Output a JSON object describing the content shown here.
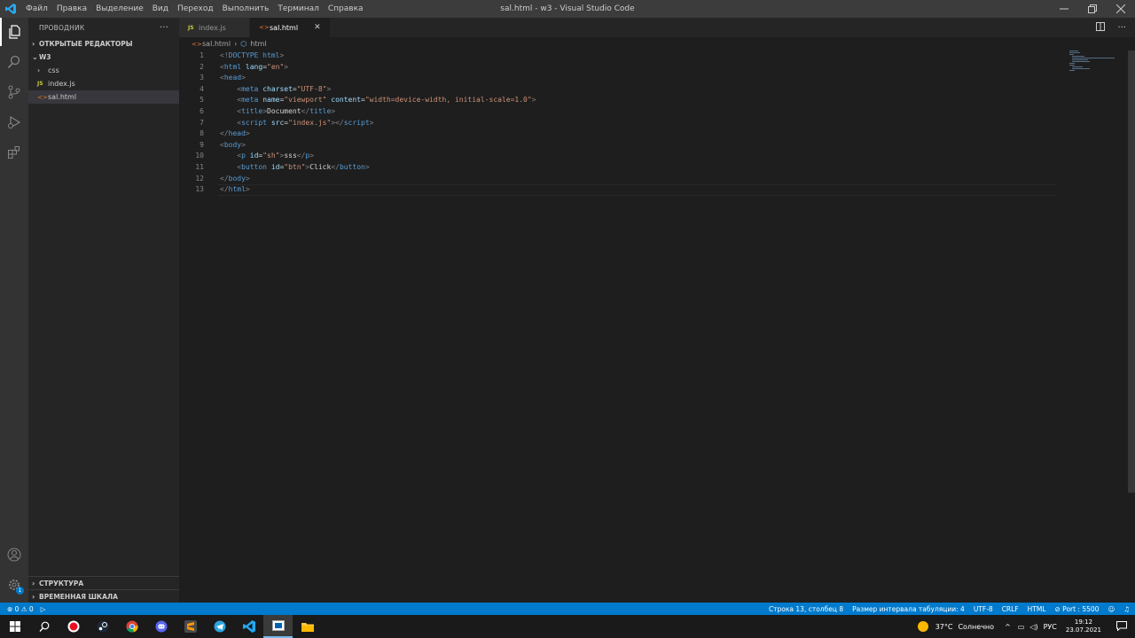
{
  "titlebar": {
    "menu": [
      "Файл",
      "Правка",
      "Выделение",
      "Вид",
      "Переход",
      "Выполнить",
      "Терминал",
      "Справка"
    ],
    "window_title": "sal.html - w3 - Visual Studio Code"
  },
  "sidebar": {
    "header": "ПРОВОДНИК",
    "more": "···",
    "open_editors": "ОТКРЫТЫЕ РЕДАКТОРЫ",
    "folder": "W3",
    "items": [
      {
        "label": "css",
        "type": "folder"
      },
      {
        "label": "index.js",
        "type": "js",
        "badge": "JS"
      },
      {
        "label": "sal.html",
        "type": "html",
        "badge": "<>"
      }
    ],
    "structure": "СТРУКТУРА",
    "timeline": "ВРЕМЕННАЯ ШКАЛА"
  },
  "tabs": [
    {
      "label": "index.js",
      "badge": "JS",
      "active": false
    },
    {
      "label": "sal.html",
      "badge": "<>",
      "active": true
    }
  ],
  "breadcrumbs": {
    "file": "sal.html",
    "symbol": "html"
  },
  "code_lines": [
    {
      "n": "1",
      "tokens": [
        [
          "p",
          "<!"
        ],
        [
          "d",
          "DOCTYPE "
        ],
        [
          "t",
          "html"
        ],
        [
          "p",
          ">"
        ]
      ]
    },
    {
      "n": "2",
      "tokens": [
        [
          "p",
          "<"
        ],
        [
          "t",
          "html"
        ],
        [
          "x",
          " "
        ],
        [
          "a",
          "lang"
        ],
        [
          "x",
          "="
        ],
        [
          "s",
          "\"en\""
        ],
        [
          "p",
          ">"
        ]
      ]
    },
    {
      "n": "3",
      "tokens": [
        [
          "p",
          "<"
        ],
        [
          "t",
          "head"
        ],
        [
          "p",
          ">"
        ]
      ]
    },
    {
      "n": "4",
      "tokens": [
        [
          "x",
          "    "
        ],
        [
          "p",
          "<"
        ],
        [
          "t",
          "meta"
        ],
        [
          "x",
          " "
        ],
        [
          "a",
          "charset"
        ],
        [
          "x",
          "="
        ],
        [
          "s",
          "\"UTF-8\""
        ],
        [
          "p",
          ">"
        ]
      ]
    },
    {
      "n": "5",
      "tokens": [
        [
          "x",
          "    "
        ],
        [
          "p",
          "<"
        ],
        [
          "t",
          "meta"
        ],
        [
          "x",
          " "
        ],
        [
          "a",
          "name"
        ],
        [
          "x",
          "="
        ],
        [
          "s",
          "\"viewport\""
        ],
        [
          "x",
          " "
        ],
        [
          "a",
          "content"
        ],
        [
          "x",
          "="
        ],
        [
          "s",
          "\"width=device-width, initial-scale=1.0\""
        ],
        [
          "p",
          ">"
        ]
      ]
    },
    {
      "n": "6",
      "tokens": [
        [
          "x",
          "    "
        ],
        [
          "p",
          "<"
        ],
        [
          "t",
          "title"
        ],
        [
          "p",
          ">"
        ],
        [
          "x",
          "Document"
        ],
        [
          "p",
          "</"
        ],
        [
          "t",
          "title"
        ],
        [
          "p",
          ">"
        ]
      ]
    },
    {
      "n": "7",
      "tokens": [
        [
          "x",
          "    "
        ],
        [
          "p",
          "<"
        ],
        [
          "t",
          "script"
        ],
        [
          "x",
          " "
        ],
        [
          "a",
          "src"
        ],
        [
          "x",
          "="
        ],
        [
          "s",
          "\"index.js\""
        ],
        [
          "p",
          "></"
        ],
        [
          "t",
          "script"
        ],
        [
          "p",
          ">"
        ]
      ]
    },
    {
      "n": "8",
      "tokens": [
        [
          "p",
          "</"
        ],
        [
          "t",
          "head"
        ],
        [
          "p",
          ">"
        ]
      ]
    },
    {
      "n": "9",
      "tokens": [
        [
          "p",
          "<"
        ],
        [
          "t",
          "body"
        ],
        [
          "p",
          ">"
        ]
      ]
    },
    {
      "n": "10",
      "tokens": [
        [
          "x",
          "    "
        ],
        [
          "p",
          "<"
        ],
        [
          "t",
          "p"
        ],
        [
          "x",
          " "
        ],
        [
          "a",
          "id"
        ],
        [
          "x",
          "="
        ],
        [
          "s",
          "\"sh\""
        ],
        [
          "p",
          ">"
        ],
        [
          "x",
          "sss"
        ],
        [
          "p",
          "</"
        ],
        [
          "t",
          "p"
        ],
        [
          "p",
          ">"
        ]
      ]
    },
    {
      "n": "11",
      "tokens": [
        [
          "x",
          "    "
        ],
        [
          "p",
          "<"
        ],
        [
          "t",
          "button"
        ],
        [
          "x",
          " "
        ],
        [
          "a",
          "id"
        ],
        [
          "x",
          "="
        ],
        [
          "s",
          "\"btn\""
        ],
        [
          "p",
          ">"
        ],
        [
          "x",
          "Click"
        ],
        [
          "p",
          "</"
        ],
        [
          "t",
          "button"
        ],
        [
          "p",
          ">"
        ]
      ]
    },
    {
      "n": "12",
      "tokens": [
        [
          "p",
          "</"
        ],
        [
          "t",
          "body"
        ],
        [
          "p",
          ">"
        ]
      ]
    },
    {
      "n": "13",
      "tokens": [
        [
          "p",
          "</"
        ],
        [
          "t",
          "html"
        ],
        [
          "p",
          ">"
        ]
      ]
    }
  ],
  "statusbar": {
    "problems": "⊗ 0 ⚠ 0",
    "run": "▷",
    "position": "Строка 13, столбец 8",
    "indent": "Размер интервала табуляции: 4",
    "encoding": "UTF-8",
    "eol": "CRLF",
    "language": "HTML",
    "port": "⊘ Port : 5500"
  },
  "taskbar": {
    "weather_temp": "37°C",
    "weather_text": "Солнечно",
    "lang": "РУС",
    "time": "19:12",
    "date": "23.07.2021",
    "badge_count": "1"
  },
  "colors": {
    "accent": "#007acc",
    "sidebar_bg": "#252526",
    "editor_bg": "#1e1e1e",
    "activity_bg": "#333333"
  }
}
